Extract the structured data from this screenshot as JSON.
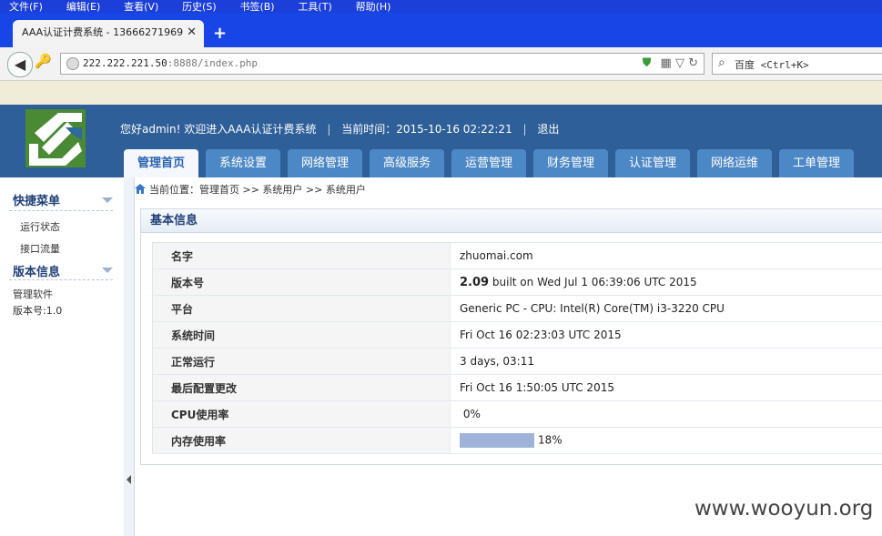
{
  "browser": {
    "menu": [
      "文件(F)",
      "编辑(E)",
      "查看(V)",
      "历史(S)",
      "书签(B)",
      "工具(T)",
      "帮助(H)"
    ],
    "tab_title": "AAA认证计费系统 - 13666271969",
    "url_host": "222.222.221.50",
    "url_rest": ":8888/index.php",
    "search_placeholder": "百度 <Ctrl+K>"
  },
  "header": {
    "welcome": "您好admin! 欢迎进入AAA认证计费系统",
    "time_label": "当前时间：",
    "time_value": "2015-10-16 02:22:21",
    "logout": "退出",
    "nav": [
      "管理首页",
      "系统设置",
      "网络管理",
      "高级服务",
      "运营管理",
      "财务管理",
      "认证管理",
      "网络运维",
      "工单管理"
    ]
  },
  "sidebar": {
    "quick_title": "快捷菜单",
    "quick_items": [
      "运行状态",
      "接口流量"
    ],
    "version_title": "版本信息",
    "version_lines": [
      "管理软件",
      "版本号:1.0"
    ]
  },
  "breadcrumb": "当前位置：管理首页 >> 系统用户 >> 系统用户",
  "panel": {
    "title": "基本信息",
    "rows": [
      {
        "key": "名字",
        "value": "zhuomai.com"
      },
      {
        "key": "版本号",
        "value_bold": "2.09",
        "value": " built on Wed Jul 1 06:39:06 UTC 2015"
      },
      {
        "key": "平台",
        "value": "Generic PC - CPU: Intel(R) Core(TM) i3-3220 CPU"
      },
      {
        "key": "系统时间",
        "value": "Fri Oct 16 02:23:03 UTC 2015"
      },
      {
        "key": "正常运行",
        "value": "3 days, 03:11"
      },
      {
        "key": "最后配置更改",
        "value": "Fri Oct 16 1:50:05 UTC 2015"
      },
      {
        "key": "CPU使用率",
        "value": "0%"
      },
      {
        "key": "内存使用率",
        "value": "18%"
      }
    ]
  },
  "watermark": "www.wooyun.org",
  "colors": {
    "header_bg": "#2e5f98",
    "nav_tab": "#4d88c6",
    "mem_bar": "#9fb3d8"
  }
}
